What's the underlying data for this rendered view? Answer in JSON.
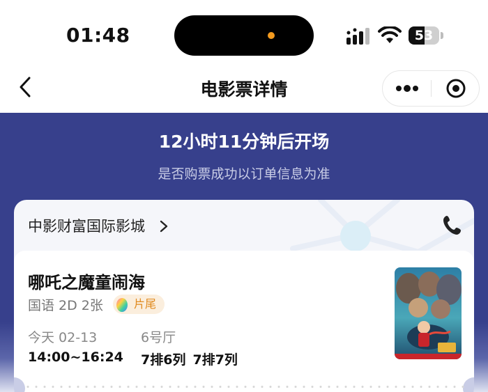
{
  "status_bar": {
    "time": "01:48",
    "battery_level": "53",
    "battery_fraction": 0.53,
    "icons": [
      "signal-icon",
      "wifi-icon",
      "battery-icon"
    ]
  },
  "nav": {
    "title": "电影票详情",
    "icons": [
      "back-icon",
      "more-icon",
      "close-target-icon"
    ]
  },
  "header": {
    "countdown": "12小时11分钟后开场",
    "notice": "是否购票成功以订单信息为准",
    "background_color": "#37408c"
  },
  "cinema": {
    "name": "中影财富国际影城",
    "icons": [
      "chevron-right-icon",
      "phone-icon"
    ]
  },
  "movie": {
    "title": "哪吒之魔童闹海",
    "meta": "国语 2D 2张",
    "end_credit_label": "片尾",
    "date": "今天 02-13",
    "hall": "6号厅",
    "time_range": "14:00~16:24",
    "seats": [
      "7排6列",
      "7排7列"
    ],
    "accent_color": "#e08a1e"
  }
}
